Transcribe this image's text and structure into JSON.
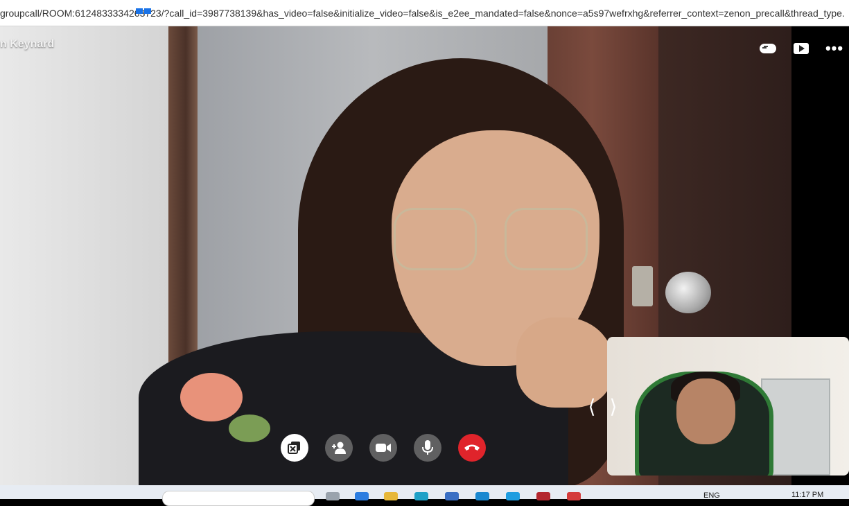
{
  "browser": {
    "url": "groupcall/ROOM:6124833334263723/?call_id=3987738139&has_video=false&initialize_video=false&is_e2ee_mandated=false&nonce=a5s97wefrxhg&referrer_context=zenon_precall&thread_type..."
  },
  "call": {
    "caller_name": "n Keynard",
    "top_icons": [
      "game-controller-icon",
      "play-icon",
      "more-options-icon"
    ],
    "controls": [
      {
        "name": "exit-fullscreen-button",
        "icon": "minimize-window-icon"
      },
      {
        "name": "add-person-button",
        "icon": "add-person-icon"
      },
      {
        "name": "camera-toggle-button",
        "icon": "video-camera-icon"
      },
      {
        "name": "microphone-toggle-button",
        "icon": "microphone-icon"
      },
      {
        "name": "end-call-button",
        "icon": "hang-up-icon"
      }
    ],
    "nav_arrows": [
      "⟨",
      "⟩"
    ]
  },
  "taskbar": {
    "language": "ENG",
    "time": "11:17 PM"
  },
  "colors": {
    "end_call": "#e0242b",
    "control_gray": "#787878",
    "taskbar": "#e7ecf3"
  }
}
